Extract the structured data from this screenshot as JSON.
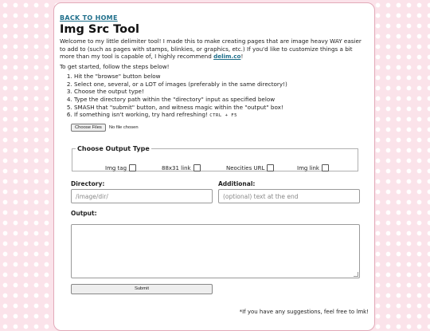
{
  "nav": {
    "back_label": "BACK TO HOME"
  },
  "page": {
    "title": "Img Src Tool"
  },
  "intro": {
    "text": "Welcome to my little delimiter tool! I made this to make creating pages that are image heavy WAY easier to add to (such as pages with stamps, blinkies, or graphics, etc.) If you'd like to customize things a bit more than my tool is capable of, I highly recommend ",
    "link_label": "delim.co",
    "text_end": "!"
  },
  "steps": {
    "lead": "To get started, follow the steps below!",
    "items": [
      "Hit the \"browse\" button below",
      "Select one, several, or a LOT of images (preferably in the same directory!)",
      "Choose the output type!",
      "Type the directory path within the \"directory\" input as specified below",
      "SMASH that \"submit\" button, and witness magic within the \"output\" box!",
      "If something isn't working, try hard refreshing! "
    ],
    "shortcut": "CTRL + F5"
  },
  "file_input": {
    "button_label": "Choose Files",
    "status": "No file chosen"
  },
  "output_type": {
    "legend": "Choose Output Type",
    "options": [
      "Img tag",
      "88x31 link",
      "Neocities URL",
      "Img link"
    ]
  },
  "directory": {
    "label": "Directory:",
    "placeholder": "/image/dir/"
  },
  "additional": {
    "label": "Additional:",
    "placeholder": "(optional) text at the end"
  },
  "output": {
    "label": "Output:",
    "value": ""
  },
  "submit": {
    "label": "Submit"
  },
  "footer": {
    "note": "*If you have any suggestions, feel free to lmk!"
  }
}
